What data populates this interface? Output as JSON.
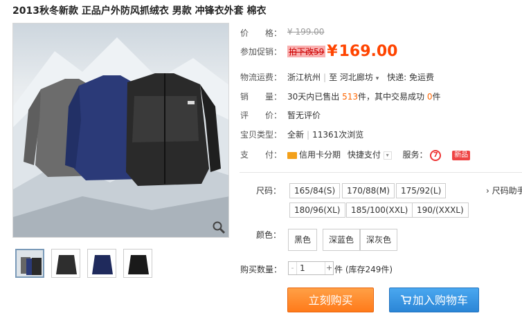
{
  "product": {
    "title": "2013秋冬新款 正品户外防风抓绒衣 男款 冲锋衣外套 棉衣"
  },
  "price": {
    "label": "价　　格：",
    "original": "¥ 199.00"
  },
  "promo": {
    "label": "参加促销：",
    "tag": "拍下改59",
    "currency": "¥",
    "amount": "169.00"
  },
  "shipping": {
    "label": "物流运费：",
    "from": "浙江杭州",
    "to_prefix": "至",
    "to": "河北廊坊",
    "fee": "快递: 免运费"
  },
  "sales": {
    "label": "销　　量：",
    "prefix": "30天内已售出",
    "count": "513",
    "middle": "件，其中交易成功",
    "success": "0",
    "suffix": "件"
  },
  "rating": {
    "label": "评　　价：",
    "value": "暂无评价"
  },
  "item_type": {
    "label": "宝贝类型：",
    "value": "全新",
    "views": "11361次浏览"
  },
  "payment": {
    "label": "支　　付：",
    "credit": "信用卡分期",
    "quick": "快捷支付",
    "service_label": "服务：",
    "new_badge": "新品"
  },
  "size": {
    "label": "尺码：",
    "options": [
      "165/84(S)",
      "170/88(M)",
      "175/92(L)",
      "180/96(XL)",
      "185/100(XXL)",
      "190/(XXXL)"
    ],
    "helper": "尺码助手"
  },
  "color": {
    "label": "颜色：",
    "options": [
      "黑色",
      "深蓝色",
      "深灰色"
    ]
  },
  "quantity": {
    "label": "购买数量：",
    "value": "1",
    "minus": "-",
    "plus": "+",
    "stock": "件 (库存249件)"
  },
  "actions": {
    "buy_now": "立刻购买",
    "add_cart": "加入购物车"
  },
  "colors": {
    "price": "#ff4400",
    "buy": "#ff7a1a",
    "cart": "#2b86d6"
  }
}
